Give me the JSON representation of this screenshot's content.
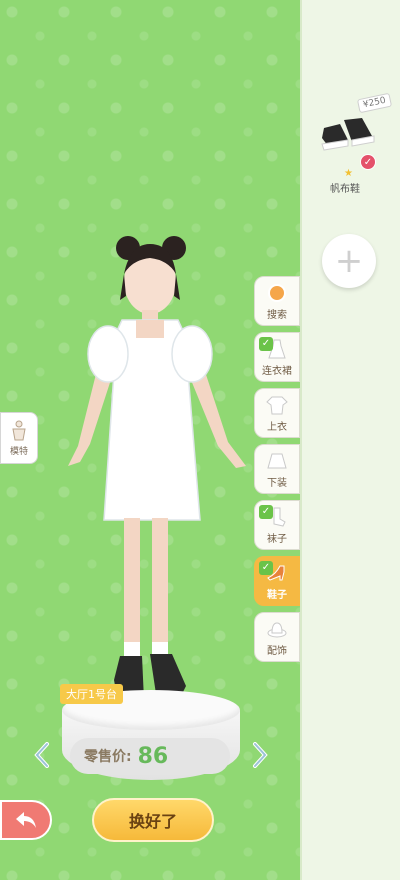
{
  "stage": {
    "platform_label": "大厅1号台",
    "price_label": "零售价:",
    "price_value": "86"
  },
  "buttons": {
    "done_label": "换好了",
    "model_label": "模特"
  },
  "tabs": [
    {
      "label": "搜索",
      "icon": "search-icon",
      "checked": false,
      "active": false
    },
    {
      "label": "连衣裙",
      "icon": "dress-icon",
      "checked": true,
      "active": false
    },
    {
      "label": "上衣",
      "icon": "shirt-icon",
      "checked": false,
      "active": false
    },
    {
      "label": "下装",
      "icon": "skirt-icon",
      "checked": false,
      "active": false
    },
    {
      "label": "袜子",
      "icon": "sock-icon",
      "checked": true,
      "active": false
    },
    {
      "label": "鞋子",
      "icon": "high-heel-icon",
      "checked": true,
      "active": true
    },
    {
      "label": "配饰",
      "icon": "hat-icon",
      "checked": false,
      "active": false
    }
  ],
  "wardrobe": {
    "item_name": "帆布鞋",
    "item_price": "¥250"
  },
  "colors": {
    "background_green": "#90d873",
    "accent_orange": "#f5b943",
    "price_green": "#67b95b"
  }
}
